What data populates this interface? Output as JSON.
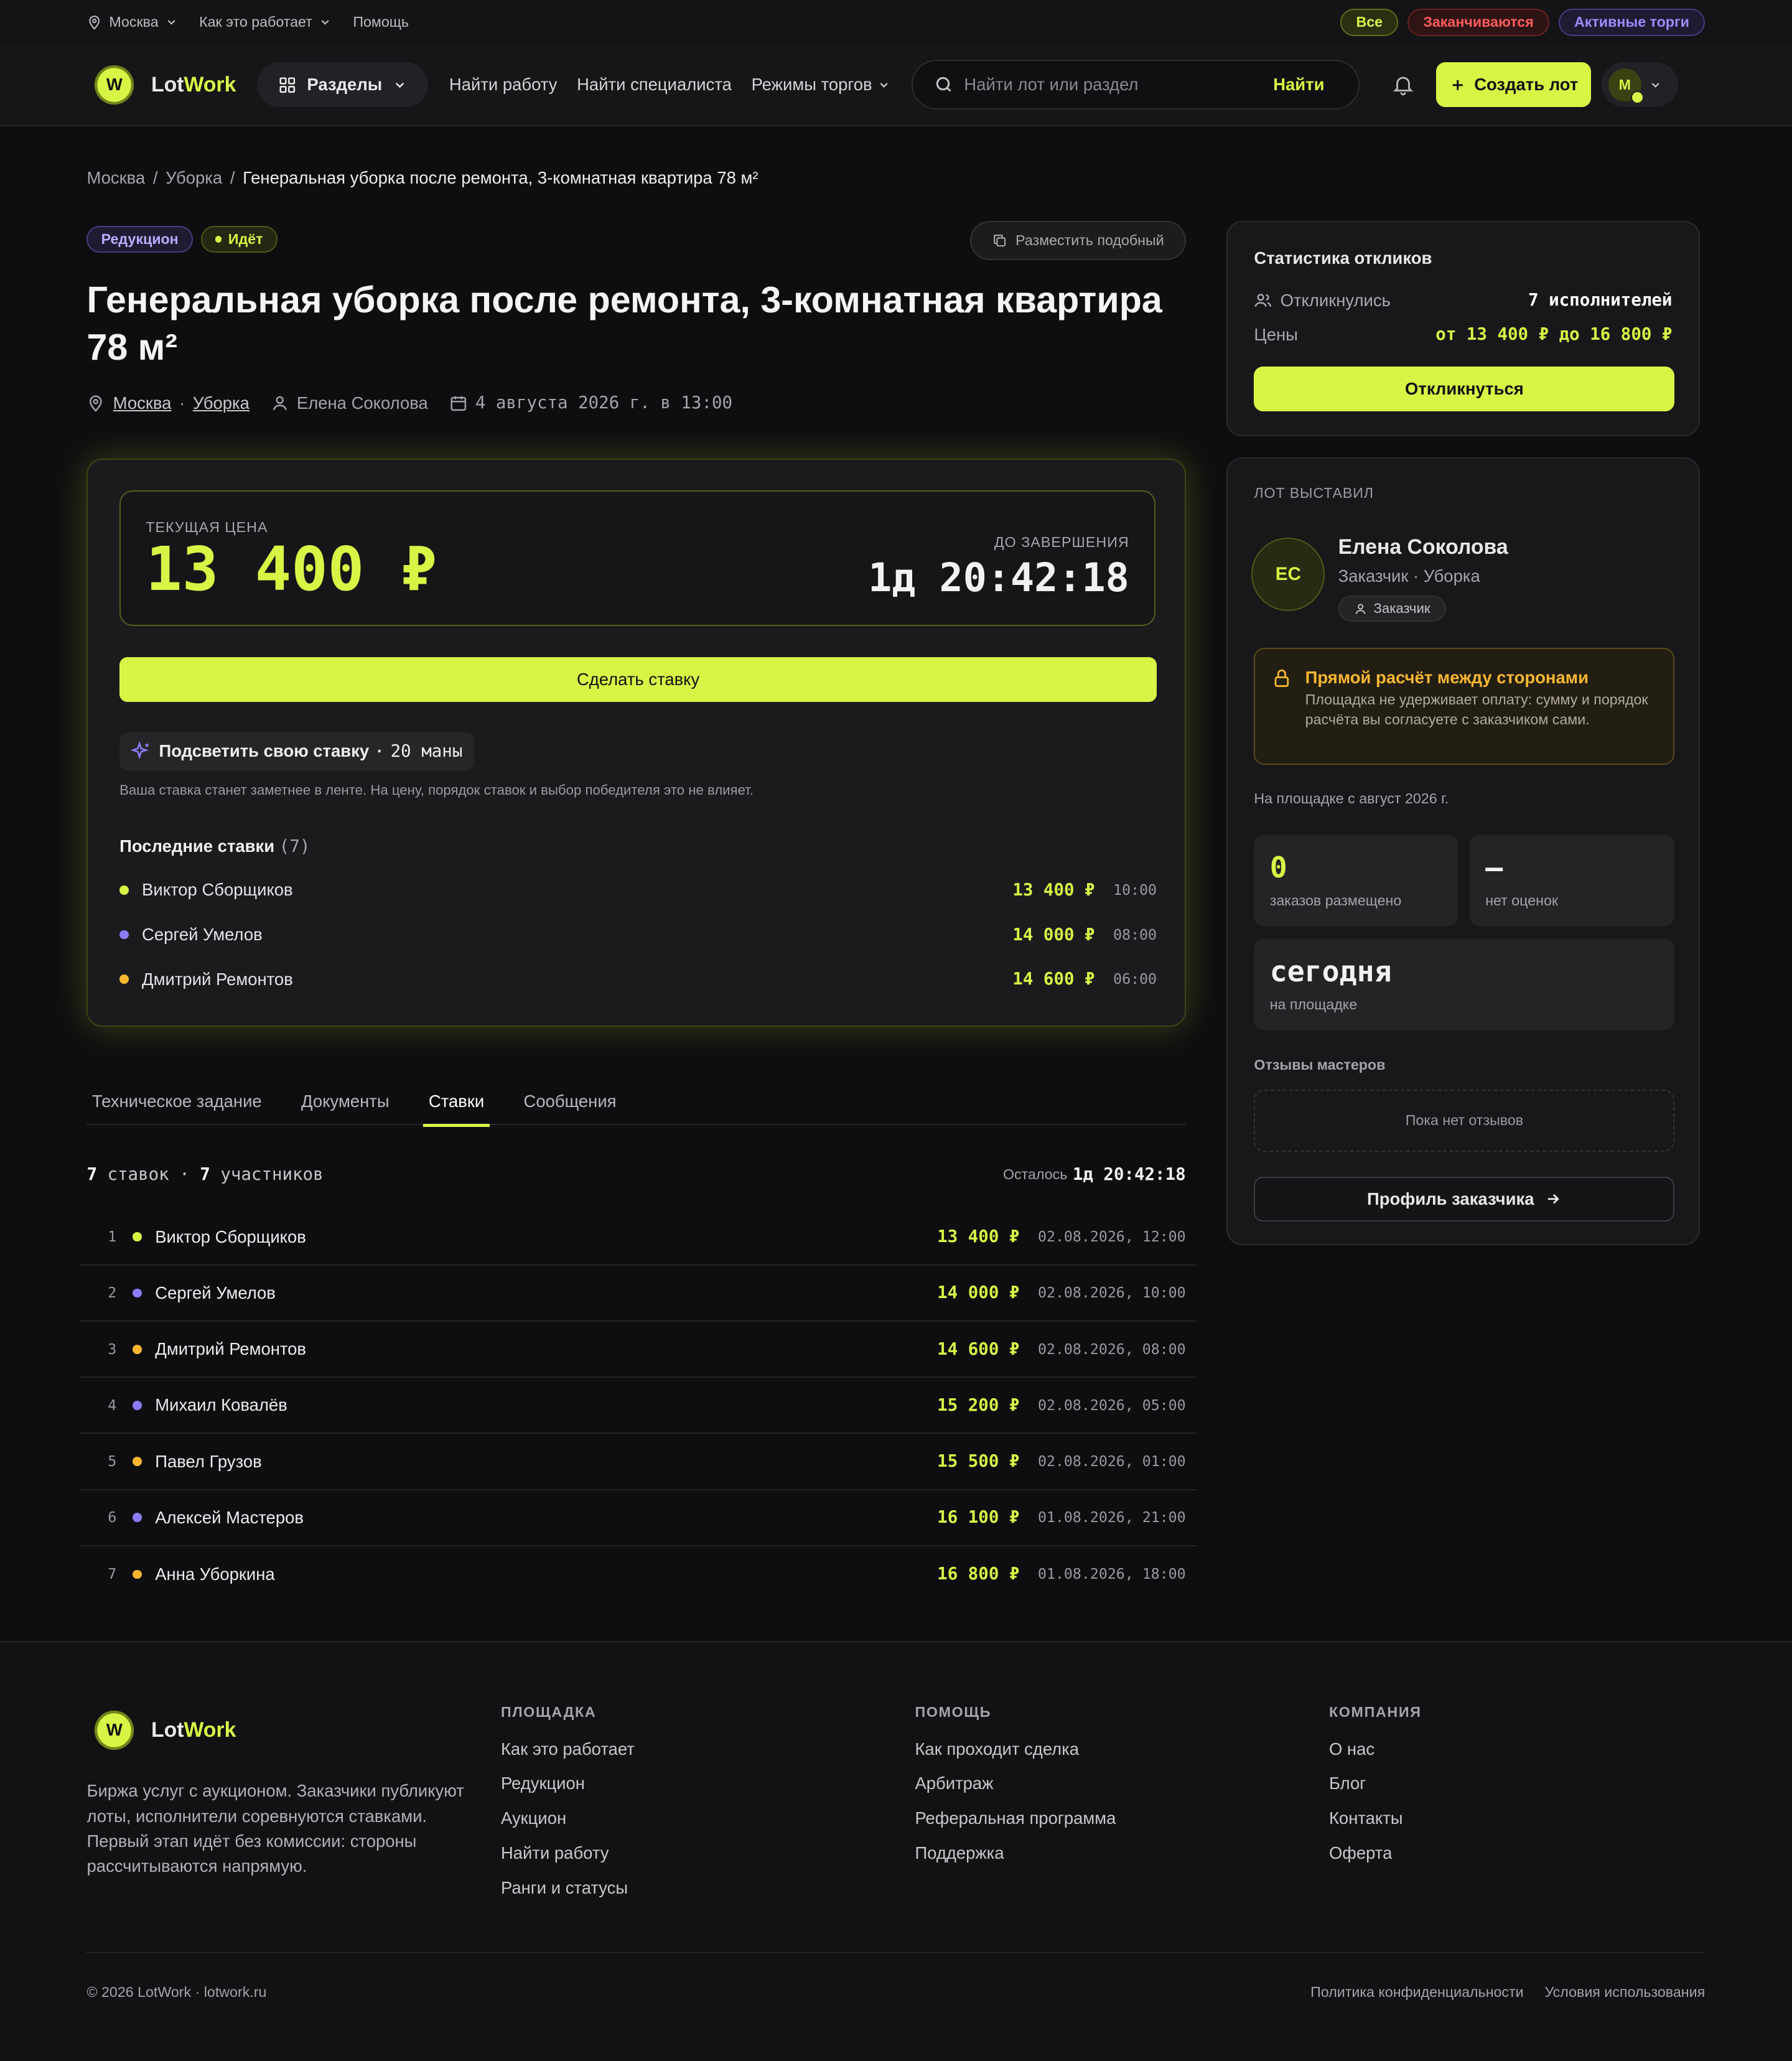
{
  "topbar": {
    "city": "Москва",
    "how_it_works": "Как это работает",
    "help": "Помощь",
    "filters": [
      "Все",
      "Заканчиваются",
      "Активные торги"
    ]
  },
  "header": {
    "brand_first": "Lot",
    "brand_second": "Work",
    "logo_letter": "W",
    "sections": "Разделы",
    "nav": [
      "Найти работу",
      "Найти специалиста",
      "Режимы торгов"
    ],
    "search_placeholder": "Найти лот или раздел",
    "search_button": "Найти",
    "create_lot": "Создать лот",
    "avatar": "М"
  },
  "breadcrumb": {
    "items": [
      "Москва",
      "Уборка"
    ],
    "current": "Генеральная уборка после ремонта, 3-комнатная квартира 78 м²"
  },
  "lot": {
    "badge_mode": "Редукцион",
    "badge_status": "Идёт",
    "place_similar": "Разместить подобный",
    "title": "Генеральная уборка после ремонта, 3-комнатная квартира 78 м²",
    "city": "Москва",
    "category": "Уборка",
    "author": "Елена Соколова",
    "date": "4 августа 2026 г. в 13:00"
  },
  "bid_panel": {
    "current_price_label": "ТЕКУЩАЯ ЦЕНА",
    "current_price": "13 400 ₽",
    "until_end_label": "ДО ЗАВЕРШЕНИЯ",
    "time_left": "1д 20:42:18",
    "make_bid": "Сделать ставку",
    "highlight_label": "Подсветить свою ставку",
    "highlight_cost": "20 маны",
    "highlight_note": "Ваша ставка станет заметнее в ленте. На цену, порядок ставок и выбор победителя это не влияет.",
    "last_bids_title": "Последние ставки",
    "last_bids_count": "(7)",
    "last_bids": [
      {
        "name": "Виктор Сборщиков",
        "price": "13 400 ₽",
        "time": "10:00",
        "color": "#d7f545"
      },
      {
        "name": "Сергей Умелов",
        "price": "14 000 ₽",
        "time": "08:00",
        "color": "#8b7cf6"
      },
      {
        "name": "Дмитрий Ремонтов",
        "price": "14 600 ₽",
        "time": "06:00",
        "color": "#f7b731"
      }
    ]
  },
  "tabs": [
    "Техническое задание",
    "Документы",
    "Ставки",
    "Сообщения"
  ],
  "active_tab": "Ставки",
  "bids_summary": {
    "bids": "7",
    "bids_word": "ставок",
    "participants": "7",
    "participants_word": "участников",
    "left_label": "Осталось",
    "left_time": "1д 20:42:18"
  },
  "bids_table": [
    {
      "n": "1",
      "name": "Виктор Сборщиков",
      "price": "13 400 ₽",
      "date": "02.08.2026, 12:00",
      "color": "#d7f545"
    },
    {
      "n": "2",
      "name": "Сергей Умелов",
      "price": "14 000 ₽",
      "date": "02.08.2026, 10:00",
      "color": "#8b7cf6"
    },
    {
      "n": "3",
      "name": "Дмитрий Ремонтов",
      "price": "14 600 ₽",
      "date": "02.08.2026, 08:00",
      "color": "#f7b731"
    },
    {
      "n": "4",
      "name": "Михаил Ковалёв",
      "price": "15 200 ₽",
      "date": "02.08.2026, 05:00",
      "color": "#8b7cf6"
    },
    {
      "n": "5",
      "name": "Павел Грузов",
      "price": "15 500 ₽",
      "date": "02.08.2026, 01:00",
      "color": "#f7b731"
    },
    {
      "n": "6",
      "name": "Алексей Мастеров",
      "price": "16 100 ₽",
      "date": "01.08.2026, 21:00",
      "color": "#8b7cf6"
    },
    {
      "n": "7",
      "name": "Анна Уборкина",
      "price": "16 800 ₽",
      "date": "01.08.2026, 18:00",
      "color": "#f7b731"
    }
  ],
  "stats": {
    "title": "Статистика откликов",
    "responded_label": "Откликнулись",
    "responded_value": "7 исполнителей",
    "prices_label": "Цены",
    "prices_value": "от 13 400 ₽ до 16 800 ₽",
    "respond_button": "Откликнуться"
  },
  "owner": {
    "caption": "ЛОТ ВЫСТАВИЛ",
    "initials": "ЕС",
    "name": "Елена Соколова",
    "subtitle": "Заказчик · Уборка",
    "role": "Заказчик",
    "warn_title": "Прямой расчёт между сторонами",
    "warn_text": "Площадка не удерживает оплату: сумму и порядок расчёта вы согласуете с заказчиком сами.",
    "since": "На площадке с август 2026 г.",
    "orders_value": "0",
    "orders_label": "заказов размещено",
    "rating_value": "—",
    "rating_label": "нет оценок",
    "today_value": "сегодня",
    "today_label": "на площадке",
    "reviews_title": "Отзывы мастеров",
    "reviews_empty": "Пока нет отзывов",
    "profile_button": "Профиль заказчика"
  },
  "footer": {
    "description": "Биржа услуг с аукционом. Заказчики публикуют лоты, исполнители соревнуются ставками. Первый этап идёт без комиссии: стороны рассчитываются напрямую.",
    "columns": [
      {
        "title": "ПЛОЩАДКА",
        "links": [
          "Как это работает",
          "Редукцион",
          "Аукцион",
          "Найти работу",
          "Ранги и статусы"
        ]
      },
      {
        "title": "ПОМОЩЬ",
        "links": [
          "Как проходит сделка",
          "Арбитраж",
          "Реферальная программа",
          "Поддержка"
        ]
      },
      {
        "title": "КОМПАНИЯ",
        "links": [
          "О нас",
          "Блог",
          "Контакты",
          "Оферта"
        ]
      }
    ],
    "copyright": "© 2026 LotWork · lotwork.ru",
    "privacy": "Политика конфиденциальности",
    "terms": "Условия использования"
  },
  "colors": {
    "accent": "#d7f545",
    "violet": "#8b7cf6",
    "amber": "#f7b731",
    "danger": "#ff5b5b"
  }
}
